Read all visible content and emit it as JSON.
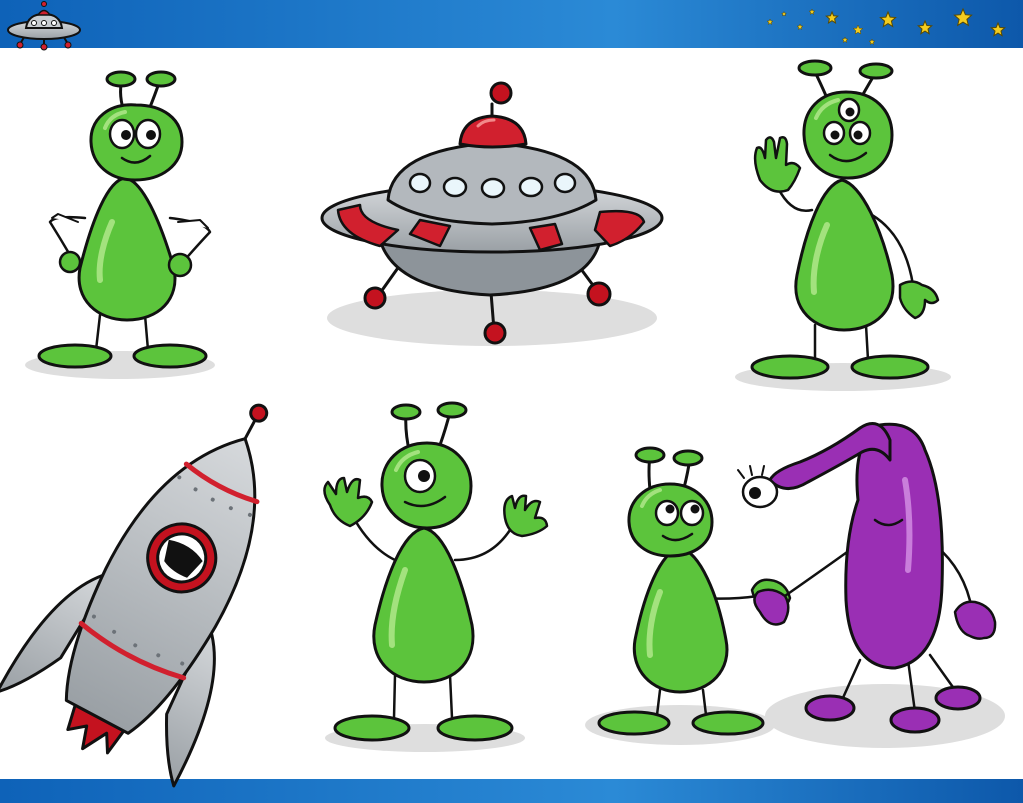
{
  "scene": {
    "subjects": [
      {
        "kind": "alien",
        "pose": "hands-on-hips",
        "eyes": 2,
        "color": "green"
      },
      {
        "kind": "flying-saucer",
        "color": "gray-red"
      },
      {
        "kind": "alien",
        "pose": "waving",
        "eyes": 3,
        "color": "green"
      },
      {
        "kind": "rocket",
        "color": "gray-red"
      },
      {
        "kind": "alien",
        "pose": "arms-raised",
        "eyes": 1,
        "color": "green"
      },
      {
        "kind": "alien",
        "pose": "handshake",
        "eyes": 2,
        "color": "green"
      },
      {
        "kind": "alien",
        "pose": "handshake",
        "eyes": 1,
        "color": "purple"
      }
    ]
  },
  "icons": [
    "ufo-logo-icon",
    "star-icon"
  ],
  "colors": {
    "banner": "#1b6fc2",
    "alien_green": "#5cc43c",
    "alien_green_light": "#a3e27e",
    "alien_purple": "#9a2fb4",
    "alien_purple_light": "#c97edb",
    "metal": "#b3b8bd",
    "metal_dark": "#8d949a",
    "accent_red": "#d1202e",
    "star": "#f3cc1e",
    "shadow": "#dedede",
    "outline": "#111111"
  }
}
